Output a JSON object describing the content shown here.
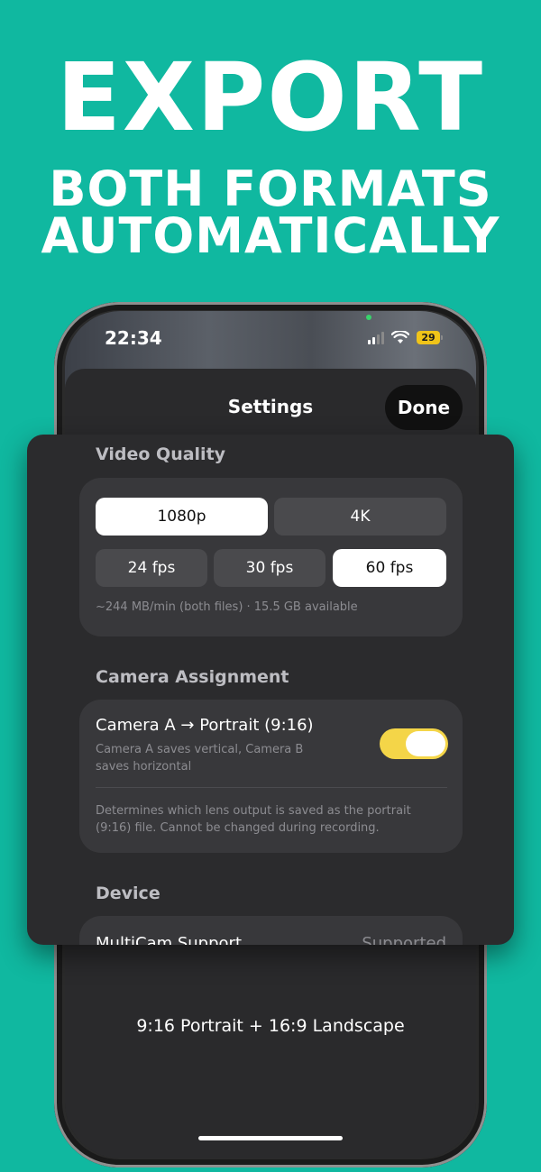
{
  "headline": {
    "line1": "EXPORT",
    "line2": "BOTH FORMATS",
    "line3": "AUTOMATICALLY"
  },
  "status_bar": {
    "time": "22:34",
    "battery": "29"
  },
  "sheet": {
    "title": "Settings",
    "done_label": "Done"
  },
  "video_quality": {
    "title": "Video Quality",
    "resolutions": [
      {
        "label": "1080p",
        "selected": true
      },
      {
        "label": "4K",
        "selected": false
      }
    ],
    "frame_rates": [
      {
        "label": "24 fps",
        "selected": false
      },
      {
        "label": "30 fps",
        "selected": false
      },
      {
        "label": "60 fps",
        "selected": true
      }
    ],
    "note": "~244 MB/min (both files) · 15.5 GB available"
  },
  "camera_assignment": {
    "title": "Camera Assignment",
    "toggle_title": "Camera A → Portrait (9:16)",
    "toggle_subtitle": "Camera A saves vertical, Camera B saves horizontal",
    "toggle_on": true,
    "note": "Determines which lens output is saved as the portrait (9:16) file. Cannot be changed during recording."
  },
  "device": {
    "title": "Device",
    "multicam_label": "MultiCam Support",
    "multicam_value": "Supported"
  },
  "bottom_caption": "9:16 Portrait + 16:9 Landscape",
  "colors": {
    "background": "#10b8a0",
    "toggle_on": "#f4d548",
    "battery": "#f0c419",
    "recording_dot": "#38d36b"
  },
  "icons": {
    "signal": "cellular-signal-icon",
    "wifi": "wifi-icon",
    "battery": "battery-icon"
  }
}
